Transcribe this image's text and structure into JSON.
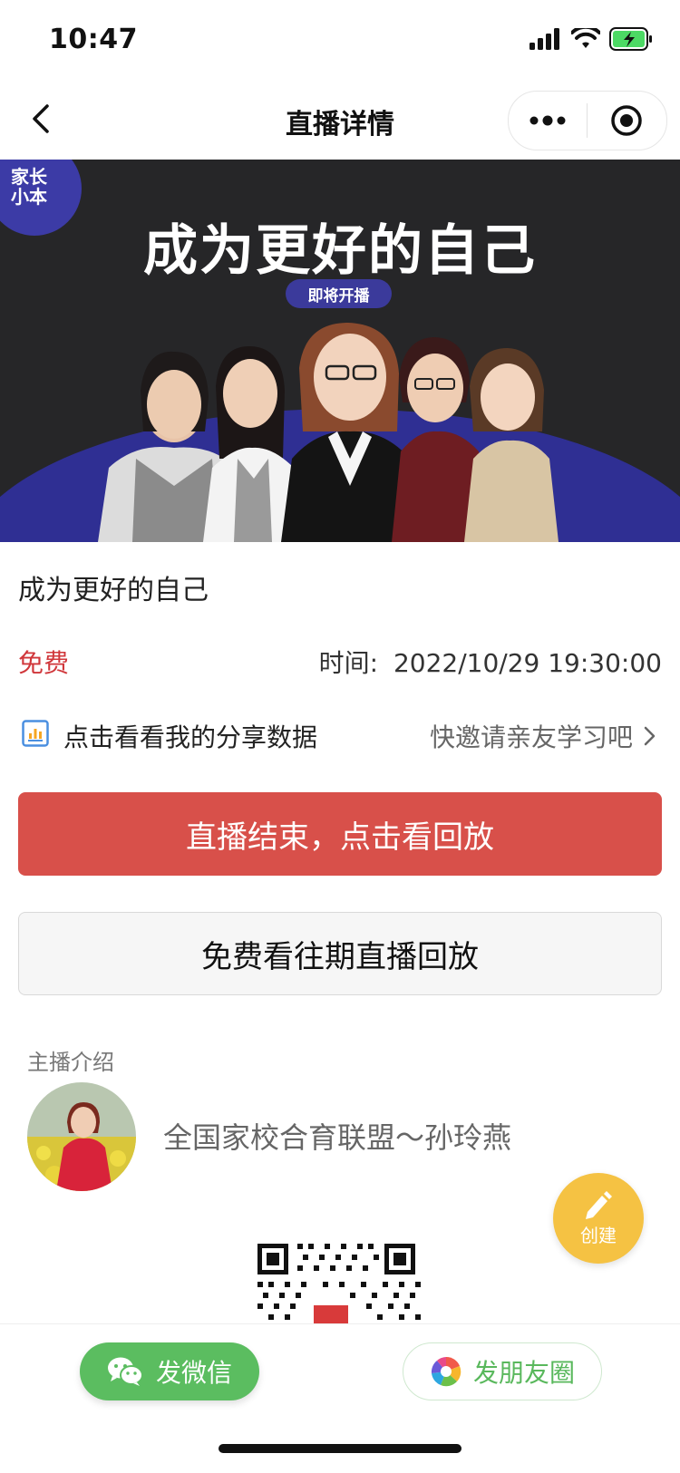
{
  "status_bar": {
    "time": "10:47"
  },
  "nav": {
    "title": "直播详情"
  },
  "banner": {
    "title": "成为更好的自己",
    "badge": "即将开播",
    "logo_line1": "家长",
    "logo_line2": "小本"
  },
  "course": {
    "title": "成为更好的自己",
    "price": "免费",
    "time_label": "时间:",
    "time_value": "2022/10/29 19:30:00"
  },
  "share": {
    "label": "点击看看我的分享数据",
    "invite": "快邀请亲友学习吧"
  },
  "buttons": {
    "replay": "直播结束，点击看回放",
    "past_replay": "免费看往期直播回放"
  },
  "host": {
    "section_label": "主播介绍",
    "name": "全国家校合育联盟～孙玲燕"
  },
  "fab": {
    "label": "创建"
  },
  "bottom": {
    "wechat": "发微信",
    "moments": "发朋友圈"
  },
  "colors": {
    "accent_red": "#d8504a",
    "price_red": "#d0363a",
    "wechat_green": "#5bbd60",
    "fab_yellow": "#f5c243",
    "banner_bg": "#262628",
    "banner_blue": "#2f2f93"
  },
  "icons": [
    "back-icon",
    "more-icon",
    "close-target-icon",
    "chart-icon",
    "chevron-right-icon",
    "pencil-icon",
    "wechat-icon",
    "moments-icon",
    "signal-icon",
    "wifi-icon",
    "battery-icon"
  ]
}
